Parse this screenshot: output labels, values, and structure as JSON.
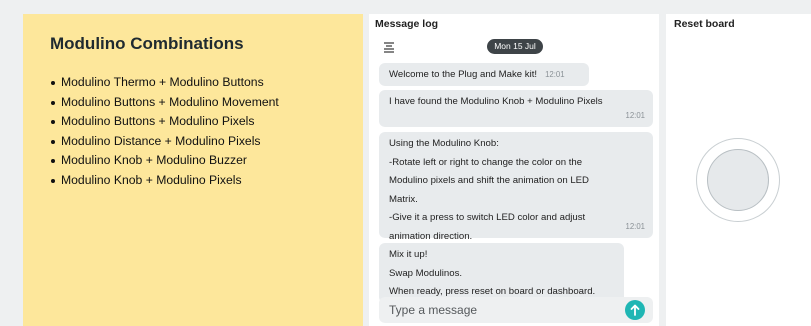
{
  "left": {
    "title": "Modulino Combinations",
    "items": [
      "Modulino Thermo + Modulino Buttons",
      "Modulino Buttons + Modulino Movement",
      "Modulino Buttons + Modulino Pixels",
      "Modulino Distance + Modulino Pixels",
      "Modulino Knob + Modulino Buzzer",
      "Modulino Knob + Modulino Pixels"
    ]
  },
  "message_log": {
    "title": "Message log",
    "toolbar_icon": "collapse-lines-icon",
    "date": "Mon 15 Jul",
    "messages": [
      {
        "lines": [
          "Welcome to the Plug and Make kit!"
        ],
        "time": "12:01"
      },
      {
        "lines": [
          "I have found the Modulino Knob + Modulino Pixels"
        ],
        "time": "12:01"
      },
      {
        "lines": [
          "Using the Modulino Knob:",
          "-Rotate left or right to change the color on the",
          "Modulino pixels and shift the animation on LED",
          "Matrix.",
          "-Give it a press to switch LED color and adjust",
          "animation direction."
        ],
        "time": "12:01"
      },
      {
        "lines": [
          "Mix it up!",
          "Swap Modulinos.",
          "When ready, press reset on board or dashboard."
        ]
      }
    ],
    "input_placeholder": "Type a message",
    "send_icon": "arrow-up-icon"
  },
  "reset": {
    "title": "Reset board",
    "control_icon": "push-button-icon"
  },
  "colors": {
    "left_panel_bg": "#fde79b",
    "date_pill_bg": "#3e4448",
    "send_button": "#1fb6b4",
    "bubble_bg": "#e8ebed"
  }
}
